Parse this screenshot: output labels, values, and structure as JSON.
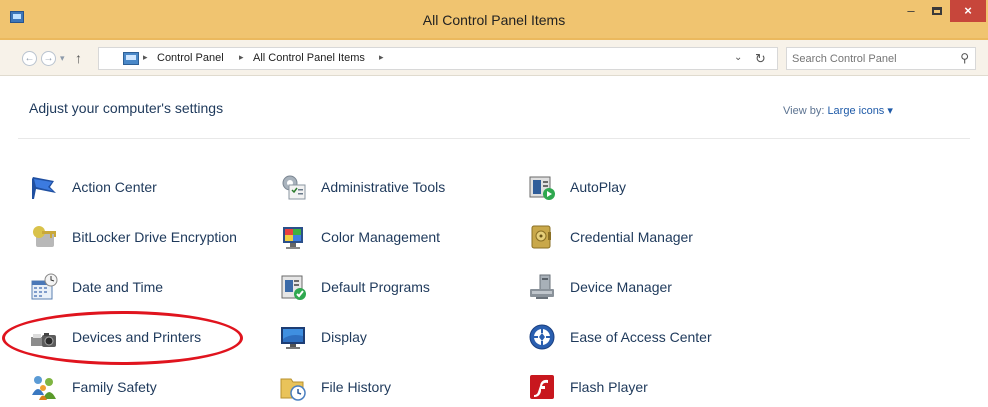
{
  "window": {
    "title": "All Control Panel Items",
    "minimize_glyph": "–",
    "close_glyph": "×"
  },
  "address": {
    "crumbs": [
      "Control Panel",
      "All Control Panel Items"
    ],
    "search_placeholder": "Search Control Panel"
  },
  "header": {
    "title": "Adjust your computer's settings",
    "view_by_label": "View by:",
    "view_by_value": "Large icons ▾"
  },
  "items": [
    {
      "label": "Action Center",
      "icon": "flag-icon"
    },
    {
      "label": "Administrative Tools",
      "icon": "admin-tools-icon"
    },
    {
      "label": "AutoPlay",
      "icon": "autoplay-icon"
    },
    {
      "label": "BitLocker Drive Encryption",
      "icon": "bitlocker-key-icon"
    },
    {
      "label": "Color Management",
      "icon": "color-management-icon"
    },
    {
      "label": "Credential Manager",
      "icon": "credential-vault-icon"
    },
    {
      "label": "Date and Time",
      "icon": "calendar-clock-icon"
    },
    {
      "label": "Default Programs",
      "icon": "default-programs-icon"
    },
    {
      "label": "Device Manager",
      "icon": "device-manager-icon"
    },
    {
      "label": "Devices and Printers",
      "icon": "printer-camera-icon"
    },
    {
      "label": "Display",
      "icon": "monitor-icon"
    },
    {
      "label": "Ease of Access Center",
      "icon": "ease-of-access-icon"
    },
    {
      "label": "Family Safety",
      "icon": "family-safety-icon"
    },
    {
      "label": "File History",
      "icon": "file-history-icon"
    },
    {
      "label": "Flash Player",
      "icon": "flash-player-icon"
    }
  ],
  "colors": {
    "titlebar": "#f0c470",
    "close_button": "#c7463b",
    "link_text": "#1e395b",
    "highlight_ring": "#e0141e"
  }
}
